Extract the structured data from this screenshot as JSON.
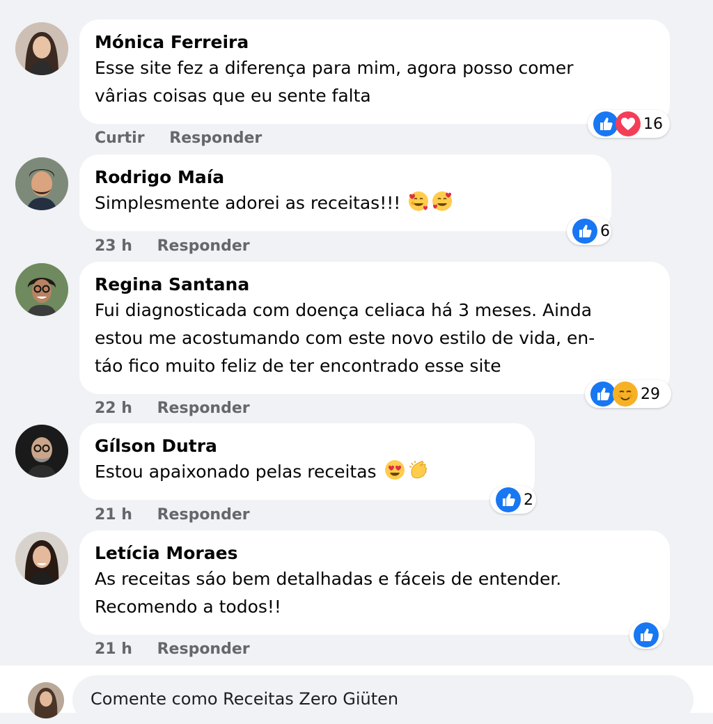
{
  "comments": [
    {
      "author": "Mónica Ferreira",
      "lines": [
        "Esse site fez a diferença para mim, agora posso comer",
        "vârias coisas que eu sente falta"
      ],
      "actions": [
        "Curtir",
        "Responder"
      ],
      "reaction_count": "16",
      "reaction_icons": [
        "like-icon",
        "love-icon"
      ]
    },
    {
      "author": "Rodrigo Maía",
      "lines": [
        "Simplesmente adorei as receitas!!!"
      ],
      "emojis": [
        "smiling-face-with-hearts-icon",
        "smiling-face-with-hearts-icon"
      ],
      "actions": [
        "23 h",
        "Responder"
      ],
      "reaction_count": "6",
      "reaction_icons": [
        "like-icon"
      ]
    },
    {
      "author": "Regina Santana",
      "lines": [
        "Fui diagnosticada com doença celiaca há 3 meses. Ainda",
        "estou me acostumando com este novo estilo de vida, en-",
        "táo fico muito feliz de ter encontrado esse site"
      ],
      "actions": [
        "22 h",
        "Responder"
      ],
      "reaction_count": "29",
      "reaction_icons": [
        "like-icon",
        "care-face-icon"
      ]
    },
    {
      "author": "Gílson Dutra",
      "lines": [
        "Estou apaixonado pelas receitas"
      ],
      "emojis": [
        "heart-eyes-icon",
        "clapping-hands-icon"
      ],
      "actions": [
        "21 h",
        "Responder"
      ],
      "reaction_count": "2",
      "reaction_icons": [
        "like-icon"
      ]
    },
    {
      "author": "Letícia Moraes",
      "lines": [
        "As receitas sáo bem detalhadas e fáceis de entender.",
        "Recomendo a todos!!"
      ],
      "actions": [
        "21 h",
        "Responder"
      ],
      "reaction_count": "",
      "reaction_icons": [
        "like-icon"
      ]
    }
  ],
  "composer": {
    "placeholder": "Comente como Receitas Zero Giüten"
  },
  "colors": {
    "background": "#f0f2f5",
    "bubble": "#ffffff",
    "like_blue": "#1877f2",
    "love_red": "#f33e58",
    "secondary_text": "#65676b"
  }
}
